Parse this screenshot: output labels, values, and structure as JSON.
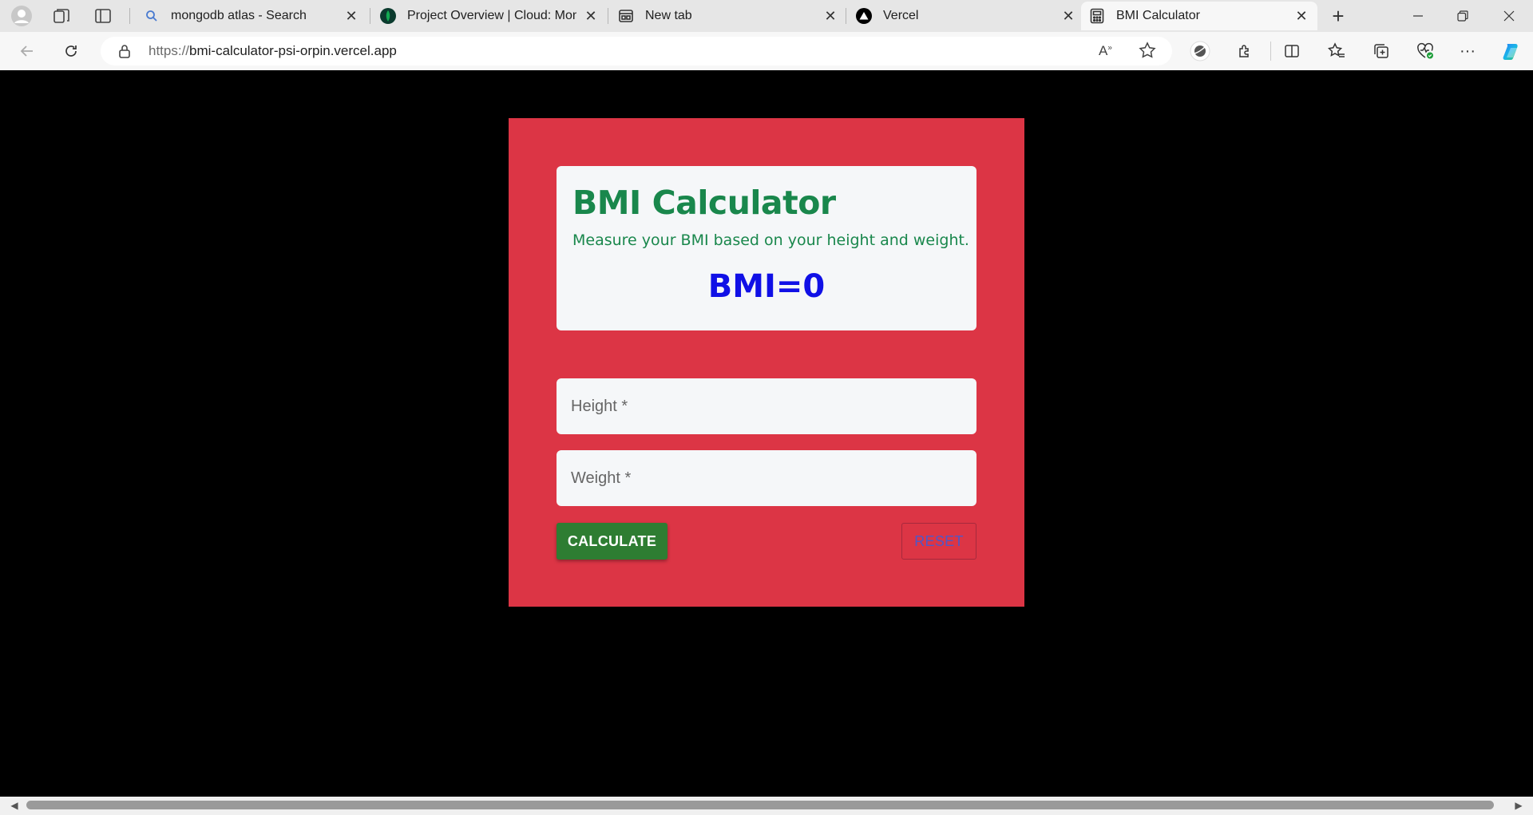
{
  "browser": {
    "tabs": [
      {
        "title": "mongodb atlas - Search",
        "icon": "search-icon",
        "active": false
      },
      {
        "title": "Project Overview | Cloud: MongoDB Cloud",
        "icon": "mongodb-leaf-icon",
        "active": false
      },
      {
        "title": "New tab",
        "icon": "new-tab-icon",
        "active": false
      },
      {
        "title": "Vercel",
        "icon": "vercel-triangle-icon",
        "active": false
      },
      {
        "title": "BMI Calculator",
        "icon": "calculator-icon",
        "active": true
      }
    ],
    "address": {
      "scheme": "https://",
      "host": "bmi-calculator-psi-orpin.vercel.app"
    }
  },
  "app": {
    "title": "BMI Calculator",
    "subtitle": "Measure your BMI based on your height and weight.",
    "bmi_display": "BMI=0",
    "height_placeholder": "Height *",
    "weight_placeholder": "Weight *",
    "calculate_label": "CALCULATE",
    "reset_label": "RESET"
  },
  "colors": {
    "card_background": "#dc3545",
    "title_color": "#19874c",
    "bmi_color": "#1010e6",
    "calculate_button": "#2e7d32",
    "reset_text": "#4f57c7",
    "page_background": "#000000"
  }
}
